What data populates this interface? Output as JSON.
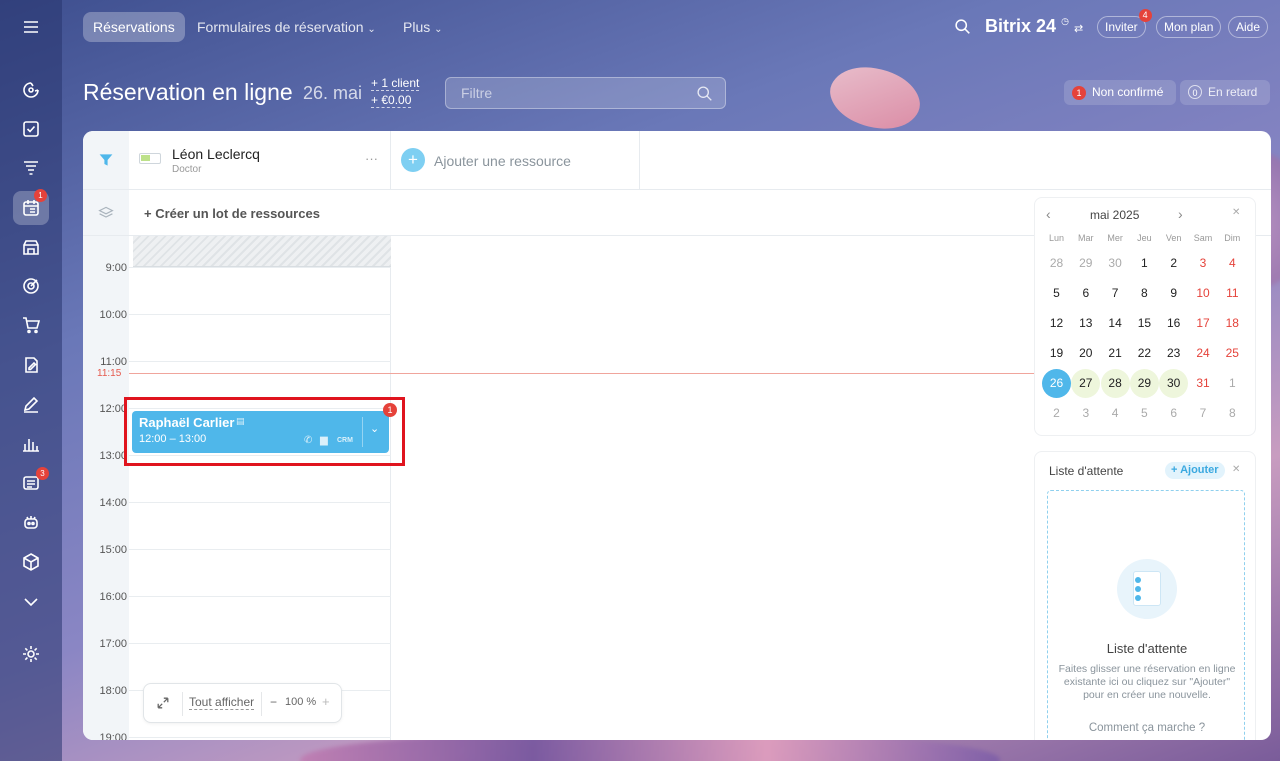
{
  "header": {
    "tabs": [
      {
        "label": "Réservations",
        "active": true
      },
      {
        "label": "Formulaires de réservation"
      },
      {
        "label": "Plus"
      }
    ],
    "brand": "Bitrix 24",
    "invite_label": "Inviter",
    "invite_badge": "4",
    "plan_label": "Mon plan",
    "help_label": "Aide"
  },
  "sidebar": {
    "items": [
      {
        "icon": "menu-icon"
      },
      {
        "icon": "activity-icon"
      },
      {
        "icon": "tasks-icon"
      },
      {
        "icon": "funnel-icon"
      },
      {
        "icon": "booking-icon",
        "badge": "1",
        "active": true
      },
      {
        "icon": "store-icon"
      },
      {
        "icon": "target-icon"
      },
      {
        "icon": "cart-icon"
      },
      {
        "icon": "sign-icon"
      },
      {
        "icon": "edit-icon"
      },
      {
        "icon": "analytics-icon"
      },
      {
        "icon": "news-icon",
        "badge": "3"
      },
      {
        "icon": "robot-icon"
      },
      {
        "icon": "box-icon"
      },
      {
        "icon": "chevron-down-icon"
      },
      {
        "icon": "settings-icon"
      }
    ]
  },
  "page": {
    "title": "Réservation en ligne",
    "date": "26. mai",
    "client_stat": "+ 1 client",
    "money_stat": "+ €0.00",
    "filter_placeholder": "Filtre",
    "status": {
      "unconfirmed_count": "1",
      "unconfirmed_label": "Non confirmé",
      "late_count": "0",
      "late_label": "En retard"
    }
  },
  "resource": {
    "name": "Léon Leclercq",
    "role": "Doctor",
    "more": "···",
    "add_label": "Ajouter une ressource",
    "lot_label": "+ Créer un lot de ressources"
  },
  "timeline": {
    "hours": [
      "9:00",
      "10:00",
      "11:00",
      "12:00",
      "13:00",
      "14:00",
      "15:00",
      "16:00",
      "17:00",
      "18:00",
      "19:00"
    ],
    "now": "11:15"
  },
  "booking": {
    "client": "Raphaël Carlier",
    "time": "12:00 – 13:00",
    "crm": "CRM",
    "badge": "1"
  },
  "zoom": {
    "show_all": "Tout afficher",
    "minus": "−",
    "level": "100 %",
    "plus": "+"
  },
  "calendar": {
    "month": "mai 2025",
    "weekdays": [
      "Lun",
      "Mar",
      "Mer",
      "Jeu",
      "Ven",
      "Sam",
      "Dim"
    ],
    "weeks": [
      [
        "28",
        "29",
        "30",
        "1",
        "2",
        "3",
        "4"
      ],
      [
        "5",
        "6",
        "7",
        "8",
        "9",
        "10",
        "11"
      ],
      [
        "12",
        "13",
        "14",
        "15",
        "16",
        "17",
        "18"
      ],
      [
        "19",
        "20",
        "21",
        "22",
        "23",
        "24",
        "25"
      ],
      [
        "26",
        "27",
        "28",
        "29",
        "30",
        "31",
        "1"
      ],
      [
        "2",
        "3",
        "4",
        "5",
        "6",
        "7",
        "8"
      ]
    ],
    "selected": "26",
    "accent": "#4fb7ea",
    "weekend_color": "#e5423a"
  },
  "waitlist": {
    "title": "Liste d'attente",
    "add_label": "+ Ajouter",
    "empty_title": "Liste d'attente",
    "empty_text": "Faites glisser une réservation en ligne existante ici ou cliquez sur \"Ajouter\" pour en créer une nouvelle.",
    "help_link": "Comment ça marche ?"
  }
}
